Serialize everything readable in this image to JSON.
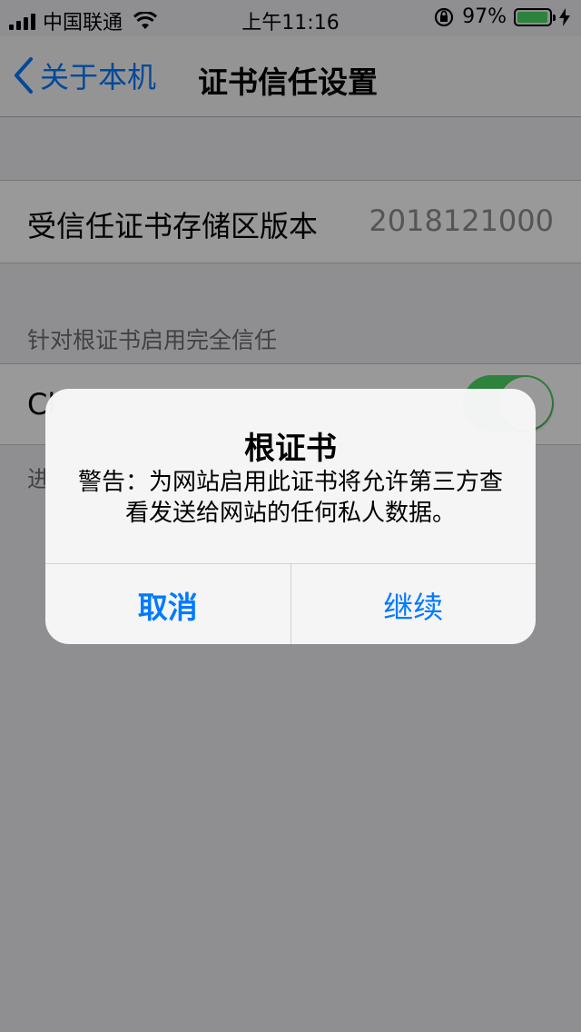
{
  "status_bar": {
    "carrier": "中国联通",
    "time": "上午11:16",
    "battery_percent_text": "97%",
    "battery_level": 0.97,
    "icons": [
      "signal-icon",
      "wifi-icon",
      "orientation-lock-icon",
      "battery-icon",
      "charging-icon"
    ]
  },
  "nav": {
    "back_label": "关于本机",
    "title": "证书信任设置"
  },
  "version_row": {
    "label": "受信任证书存储区版本",
    "value": "2018121000"
  },
  "section": {
    "header": "针对根证书启用完全信任",
    "cert_label": "Cl",
    "footer": "进",
    "toggle_on": true
  },
  "alert": {
    "title": "根证书",
    "message": "警告：为网站启用此证书将允许第三方查看发送给网站的任何私人数据。",
    "cancel_label": "取消",
    "continue_label": "继续"
  },
  "colors": {
    "accent": "#007aff",
    "toggle_on": "#4cd964",
    "battery_fill": "#4cd964"
  }
}
